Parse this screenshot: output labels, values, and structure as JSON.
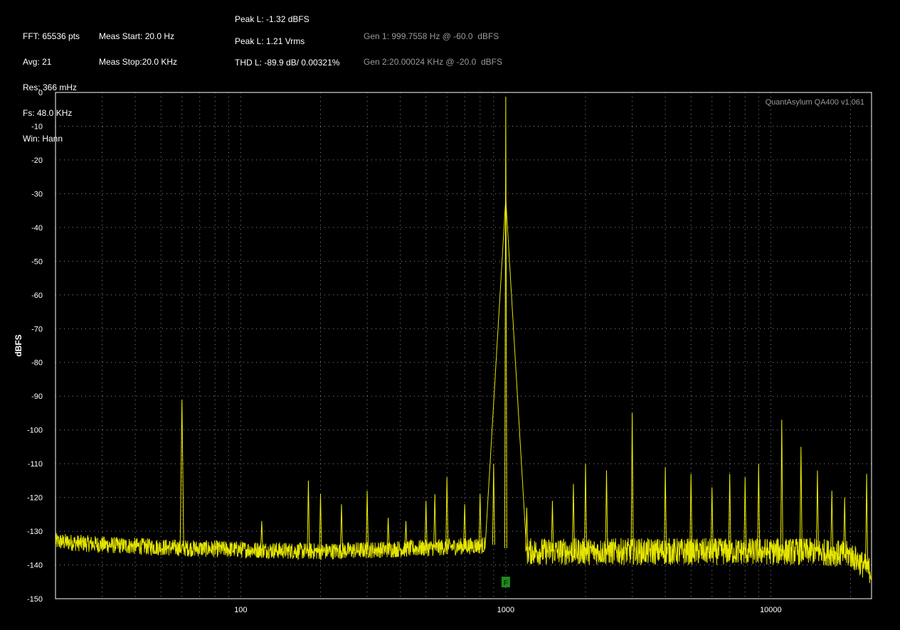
{
  "header": {
    "col1": [
      "FFT: 65536 pts",
      "Avg: 21",
      "Res: 366 mHz",
      "Fs: 48.0 KHz",
      "Win: Hann"
    ],
    "col2": [
      "Meas Start: 20.0 Hz",
      "Meas Stop:20.0 KHz"
    ],
    "peak_db": "Peak L: -1.32 dBFS",
    "peak_vrms": "Peak L: 1.21 Vrms",
    "thd": "THD L: -89.9 dB/ 0.00321%",
    "gen1": "Gen 1: 999.7558 Hz @ -60.0  dBFS",
    "gen2": "Gen 2:20.00024 KHz @ -20.0  dBFS"
  },
  "chart_data": {
    "type": "line",
    "title": "",
    "watermark": "QuantAsylum QA400 v1.061",
    "xlabel": "",
    "ylabel": "dBFS",
    "x_scale": "log",
    "xlim": [
      20,
      24000
    ],
    "ylim": [
      -150,
      0
    ],
    "x_ticks": [
      100,
      1000,
      10000
    ],
    "x_tick_labels": [
      "100",
      "1000",
      "10000"
    ],
    "y_ticks": [
      0,
      -10,
      -20,
      -30,
      -40,
      -50,
      -60,
      -70,
      -80,
      -90,
      -100,
      -110,
      -120,
      -130,
      -140,
      -150
    ],
    "grid": true,
    "marker": {
      "label": "F",
      "x": 1000,
      "color": "#1e8a1e"
    },
    "colors": {
      "trace": "#f0f000",
      "background": "#000000",
      "axis": "#ffffff",
      "grid": "#c8c8c8"
    },
    "series": [
      {
        "noise_floor": [
          [
            20,
            -133
          ],
          [
            30,
            -134
          ],
          [
            60,
            -135
          ],
          [
            200,
            -136
          ],
          [
            500,
            -135
          ],
          [
            900,
            -134
          ],
          [
            1100,
            -136
          ],
          [
            5000,
            -136
          ],
          [
            15000,
            -136
          ],
          [
            20000,
            -137
          ],
          [
            24000,
            -142
          ]
        ],
        "peaks": [
          {
            "x": 60,
            "y": -91
          },
          {
            "x": 120,
            "y": -127
          },
          {
            "x": 180,
            "y": -115
          },
          {
            "x": 200,
            "y": -119
          },
          {
            "x": 240,
            "y": -122
          },
          {
            "x": 300,
            "y": -118
          },
          {
            "x": 360,
            "y": -126
          },
          {
            "x": 420,
            "y": -127
          },
          {
            "x": 500,
            "y": -121
          },
          {
            "x": 540,
            "y": -119
          },
          {
            "x": 600,
            "y": -114
          },
          {
            "x": 700,
            "y": -122
          },
          {
            "x": 800,
            "y": -119
          },
          {
            "x": 900,
            "y": -110
          },
          {
            "x": 1000,
            "y": -1.3
          },
          {
            "x": 1200,
            "y": -123
          },
          {
            "x": 1500,
            "y": -121
          },
          {
            "x": 1800,
            "y": -116
          },
          {
            "x": 2000,
            "y": -110
          },
          {
            "x": 2400,
            "y": -112
          },
          {
            "x": 3000,
            "y": -95
          },
          {
            "x": 4000,
            "y": -111
          },
          {
            "x": 5000,
            "y": -113
          },
          {
            "x": 6000,
            "y": -117
          },
          {
            "x": 7000,
            "y": -113
          },
          {
            "x": 8000,
            "y": -114
          },
          {
            "x": 9000,
            "y": -110
          },
          {
            "x": 11000,
            "y": -97
          },
          {
            "x": 13000,
            "y": -105
          },
          {
            "x": 15000,
            "y": -112
          },
          {
            "x": 17000,
            "y": -118
          },
          {
            "x": 19000,
            "y": -120
          },
          {
            "x": 23000,
            "y": -113
          }
        ]
      }
    ]
  }
}
